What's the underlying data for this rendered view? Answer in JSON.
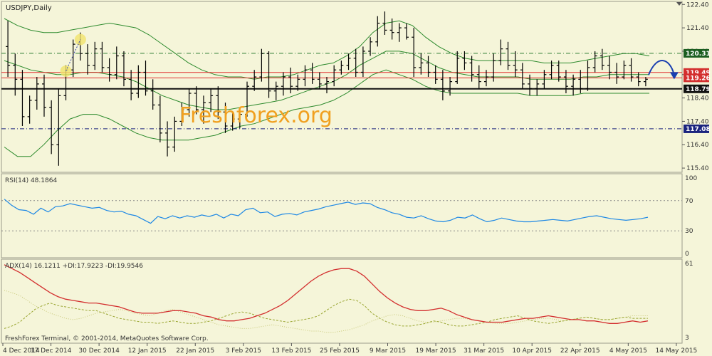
{
  "window": {
    "title": "USDJPY,Daily",
    "watermark": "Freshforex.org",
    "copyright": "FreshForex Terminal, © 2001-2014, MetaQuotes Software Corp."
  },
  "chart_data": {
    "type": "candlestick-ohlc",
    "symbol": "USDJPY",
    "timeframe": "Daily",
    "price_axis": {
      "ylim": [
        115.25,
        122.5
      ],
      "ticks": [
        122.4,
        121.4,
        120.4,
        119.4,
        118.4,
        117.4,
        116.4,
        115.4
      ],
      "tick_labels": [
        "122.40",
        "121.40",
        "120.40",
        "119.40",
        "118.40",
        "117.40",
        "116.40",
        "115.40"
      ]
    },
    "x_axis": {
      "labels": [
        "4 Dec 2014",
        "17 Dec 2014",
        "30 Dec 2014",
        "12 Jan 2015",
        "22 Jan 2015",
        "3 Feb 2015",
        "13 Feb 2015",
        "25 Feb 2015",
        "9 Mar 2015",
        "19 Mar 2015",
        "31 Mar 2015",
        "10 Apr 2015",
        "22 Apr 2015",
        "4 May 2015",
        "14 May 2015"
      ]
    },
    "levels": [
      {
        "value": 120.31,
        "label": "120.31",
        "style": "dash-dot",
        "color": "#2e7d32",
        "tag_bg": "#1b5e20"
      },
      {
        "value": 119.49,
        "label": "119.49",
        "style": "solid",
        "color": "#e03030",
        "tag_bg": "#d32f2f"
      },
      {
        "value": 119.26,
        "label": "119.26",
        "style": "solid",
        "color": "#e03030",
        "tag_bg": "#d32f2f"
      },
      {
        "value": 118.79,
        "label": "118.79",
        "style": "solid-thick",
        "color": "#111111",
        "tag_bg": "#111111"
      },
      {
        "value": 117.08,
        "label": "117.08",
        "style": "dash-dot",
        "color": "#1a237e",
        "tag_bg": "#1a237e"
      }
    ],
    "bollinger": {
      "upper": [
        121.8,
        121.5,
        121.3,
        121.2,
        121.2,
        121.3,
        121.4,
        121.5,
        121.6,
        121.5,
        121.4,
        121.1,
        120.7,
        120.3,
        119.9,
        119.6,
        119.4,
        119.3,
        119.3,
        119.2,
        119.3,
        119.3,
        119.4,
        119.6,
        119.8,
        119.9,
        120.2,
        120.6,
        121.2,
        121.6,
        121.7,
        121.5,
        121.0,
        120.6,
        120.3,
        120.1,
        120.0,
        120.0,
        120.0,
        120.0,
        120.0,
        119.9,
        119.9,
        119.9,
        120.0,
        120.1,
        120.2,
        120.3,
        120.3,
        120.2
      ],
      "middle": [
        120.0,
        119.8,
        119.6,
        119.5,
        119.4,
        119.4,
        119.5,
        119.5,
        119.4,
        119.3,
        119.1,
        118.8,
        118.5,
        118.3,
        118.1,
        118.0,
        117.9,
        117.9,
        118.0,
        118.1,
        118.2,
        118.3,
        118.5,
        118.7,
        118.9,
        119.1,
        119.4,
        119.8,
        120.1,
        120.4,
        120.4,
        120.3,
        120.0,
        119.7,
        119.5,
        119.4,
        119.3,
        119.3,
        119.3,
        119.3,
        119.2,
        119.2,
        119.2,
        119.2,
        119.3,
        119.3,
        119.4,
        119.4,
        119.4,
        119.4
      ],
      "lower": [
        116.3,
        115.9,
        115.9,
        116.4,
        117.0,
        117.5,
        117.7,
        117.7,
        117.5,
        117.2,
        116.9,
        116.7,
        116.6,
        116.6,
        116.6,
        116.7,
        116.8,
        117.0,
        117.2,
        117.3,
        117.5,
        117.7,
        117.9,
        118.0,
        118.1,
        118.3,
        118.6,
        119.0,
        119.4,
        119.6,
        119.4,
        119.2,
        118.9,
        118.7,
        118.6,
        118.6,
        118.6,
        118.6,
        118.6,
        118.6,
        118.5,
        118.5,
        118.5,
        118.5,
        118.6,
        118.6,
        118.6,
        118.6,
        118.6,
        118.6
      ]
    },
    "ohlc": [
      [
        120.6,
        121.7,
        119.3,
        119.8
      ],
      [
        119.8,
        120.3,
        118.5,
        119.2
      ],
      [
        119.2,
        119.6,
        117.2,
        117.6
      ],
      [
        117.6,
        118.5,
        117.3,
        118.3
      ],
      [
        118.3,
        119.3,
        117.9,
        119.0
      ],
      [
        119.0,
        119.4,
        117.6,
        118.0
      ],
      [
        118.0,
        118.3,
        116.0,
        116.4
      ],
      [
        116.4,
        118.8,
        115.5,
        118.5
      ],
      [
        118.5,
        119.8,
        118.3,
        119.6
      ],
      [
        119.6,
        120.9,
        119.3,
        120.7
      ],
      [
        120.7,
        121.2,
        120.0,
        120.3
      ],
      [
        120.3,
        120.7,
        119.4,
        119.8
      ],
      [
        119.8,
        120.8,
        119.6,
        120.5
      ],
      [
        120.5,
        120.8,
        119.5,
        119.7
      ],
      [
        119.7,
        120.1,
        119.1,
        119.4
      ],
      [
        119.4,
        120.6,
        119.2,
        120.2
      ],
      [
        120.2,
        120.4,
        118.9,
        119.2
      ],
      [
        119.2,
        119.6,
        118.3,
        118.6
      ],
      [
        118.6,
        119.8,
        118.4,
        119.5
      ],
      [
        119.5,
        120.0,
        118.5,
        118.7
      ],
      [
        118.7,
        119.2,
        117.9,
        118.1
      ],
      [
        118.1,
        118.5,
        116.5,
        116.9
      ],
      [
        116.9,
        117.4,
        115.9,
        116.3
      ],
      [
        116.3,
        117.6,
        116.1,
        117.4
      ],
      [
        117.4,
        118.2,
        117.2,
        117.9
      ],
      [
        117.9,
        118.8,
        117.6,
        118.6
      ],
      [
        118.6,
        118.9,
        117.7,
        117.9
      ],
      [
        117.9,
        118.5,
        117.3,
        118.2
      ],
      [
        118.2,
        118.8,
        117.8,
        118.5
      ],
      [
        118.5,
        118.9,
        117.5,
        117.8
      ],
      [
        117.8,
        118.2,
        116.9,
        117.2
      ],
      [
        117.2,
        117.8,
        117.0,
        117.5
      ],
      [
        117.5,
        117.9,
        117.1,
        117.7
      ],
      [
        117.7,
        119.1,
        117.6,
        118.9
      ],
      [
        118.9,
        119.6,
        118.7,
        119.3
      ],
      [
        119.3,
        120.5,
        119.1,
        120.3
      ],
      [
        120.3,
        120.4,
        118.4,
        118.7
      ],
      [
        118.7,
        119.1,
        118.3,
        118.9
      ],
      [
        118.9,
        119.5,
        118.5,
        119.3
      ],
      [
        119.3,
        119.7,
        118.6,
        118.9
      ],
      [
        118.9,
        119.4,
        118.7,
        119.2
      ],
      [
        119.2,
        119.8,
        118.9,
        119.6
      ],
      [
        119.6,
        119.9,
        119.0,
        119.2
      ],
      [
        119.2,
        119.5,
        118.8,
        119.0
      ],
      [
        119.0,
        119.3,
        118.6,
        119.1
      ],
      [
        119.1,
        119.8,
        118.9,
        119.6
      ],
      [
        119.6,
        120.0,
        119.4,
        119.8
      ],
      [
        119.8,
        120.3,
        119.6,
        120.1
      ],
      [
        120.1,
        120.5,
        119.3,
        119.5
      ],
      [
        119.5,
        120.6,
        119.3,
        120.4
      ],
      [
        120.4,
        121.0,
        120.2,
        120.8
      ],
      [
        120.8,
        121.9,
        120.6,
        121.6
      ],
      [
        121.6,
        122.1,
        121.1,
        121.3
      ],
      [
        121.3,
        121.8,
        120.9,
        121.2
      ],
      [
        121.2,
        121.6,
        120.8,
        121.4
      ],
      [
        121.4,
        121.6,
        120.9,
        121.0
      ],
      [
        121.0,
        121.4,
        119.3,
        119.7
      ],
      [
        119.7,
        120.3,
        119.4,
        119.9
      ],
      [
        119.9,
        120.2,
        119.3,
        119.5
      ],
      [
        119.5,
        119.8,
        119.0,
        119.2
      ],
      [
        119.2,
        119.6,
        118.3,
        118.7
      ],
      [
        118.7,
        119.3,
        118.5,
        119.1
      ],
      [
        119.1,
        120.4,
        119.0,
        120.1
      ],
      [
        120.1,
        120.4,
        119.6,
        119.9
      ],
      [
        119.9,
        120.2,
        119.1,
        119.4
      ],
      [
        119.4,
        119.8,
        118.8,
        119.1
      ],
      [
        119.1,
        119.6,
        118.9,
        119.3
      ],
      [
        119.3,
        120.3,
        119.1,
        120.0
      ],
      [
        120.0,
        120.9,
        119.8,
        120.5
      ],
      [
        120.5,
        120.8,
        119.6,
        119.8
      ],
      [
        119.8,
        120.4,
        119.3,
        119.6
      ],
      [
        119.6,
        119.9,
        118.8,
        119.0
      ],
      [
        119.0,
        119.4,
        118.5,
        118.8
      ],
      [
        118.8,
        119.2,
        118.5,
        119.0
      ],
      [
        119.0,
        119.6,
        118.8,
        119.4
      ],
      [
        119.4,
        120.0,
        119.2,
        119.8
      ],
      [
        119.8,
        120.0,
        119.1,
        119.3
      ],
      [
        119.3,
        119.6,
        118.6,
        118.9
      ],
      [
        118.9,
        119.4,
        118.5,
        119.2
      ],
      [
        119.2,
        119.6,
        118.6,
        118.8
      ],
      [
        118.8,
        120.0,
        118.7,
        119.7
      ],
      [
        119.7,
        120.4,
        119.5,
        120.2
      ],
      [
        120.2,
        120.5,
        119.6,
        119.8
      ],
      [
        119.8,
        120.2,
        119.2,
        119.5
      ],
      [
        119.5,
        119.9,
        119.0,
        119.3
      ],
      [
        119.3,
        120.0,
        119.2,
        119.8
      ],
      [
        119.8,
        120.1,
        119.1,
        119.3
      ],
      [
        119.3,
        119.5,
        118.9,
        119.1
      ],
      [
        119.1,
        119.3,
        118.9,
        119.2
      ]
    ],
    "highlights": [
      {
        "index": 8,
        "price": 119.55
      },
      {
        "index": 10,
        "price": 120.9
      }
    ],
    "rsi": {
      "label": "RSI(14) 48.1864",
      "period": 14,
      "value": 48.1864,
      "ylim": [
        0,
        100
      ],
      "ticks": [
        100,
        70,
        30,
        0
      ],
      "levels": [
        70,
        30
      ],
      "values": [
        72,
        64,
        58,
        57,
        52,
        60,
        55,
        62,
        63,
        66,
        64,
        62,
        60,
        61,
        57,
        55,
        56,
        52,
        50,
        45,
        40,
        49,
        46,
        50,
        47,
        50,
        48,
        51,
        49,
        52,
        47,
        52,
        50,
        58,
        60,
        54,
        55,
        49,
        52,
        53,
        51,
        55,
        57,
        59,
        62,
        64,
        66,
        68,
        65,
        67,
        66,
        61,
        58,
        54,
        52,
        48,
        47,
        50,
        46,
        43,
        42,
        44,
        48,
        47,
        51,
        46,
        42,
        44,
        47,
        45,
        43,
        42,
        42,
        43,
        44,
        45,
        44,
        43,
        45,
        47,
        49,
        50,
        48,
        46,
        45,
        44,
        45,
        46,
        48
      ]
    },
    "adx": {
      "label": "ADX(14) 16.1211 +DI:17.9223 -DI:19.9546",
      "period": 14,
      "adx_value": 16.1211,
      "plus_di": 17.9223,
      "minus_di": 19.9546,
      "ylim": [
        3,
        61
      ],
      "ticks": [
        61,
        3
      ],
      "adx": [
        60,
        57,
        54,
        50,
        46,
        42,
        38,
        35,
        33,
        32,
        31,
        30,
        30,
        29,
        28,
        27,
        25,
        23,
        22,
        22,
        22,
        23,
        24,
        24,
        23,
        22,
        20,
        19,
        17,
        16,
        16,
        17,
        18,
        20,
        22,
        25,
        28,
        32,
        37,
        42,
        47,
        51,
        54,
        56,
        57,
        57,
        55,
        51,
        45,
        39,
        34,
        30,
        27,
        25,
        24,
        24,
        25,
        26,
        24,
        21,
        19,
        17,
        16,
        15,
        15,
        15,
        16,
        17,
        18,
        18,
        19,
        20,
        19,
        18,
        17,
        17,
        16,
        16,
        15,
        14,
        14,
        15,
        16,
        15,
        16
      ],
      "plus_di_values": [
        10,
        12,
        15,
        20,
        25,
        28,
        30,
        28,
        27,
        26,
        25,
        24,
        24,
        22,
        20,
        18,
        17,
        16,
        15,
        15,
        14,
        15,
        16,
        15,
        14,
        14,
        15,
        16,
        18,
        20,
        22,
        23,
        22,
        20,
        18,
        17,
        16,
        15,
        16,
        17,
        18,
        20,
        24,
        28,
        31,
        33,
        32,
        28,
        22,
        18,
        15,
        13,
        12,
        12,
        13,
        14,
        16,
        15,
        13,
        12,
        12,
        13,
        14,
        15,
        17,
        18,
        19,
        20,
        18,
        16,
        15,
        14,
        15,
        16,
        17,
        18,
        19,
        18,
        17,
        17,
        18,
        19,
        18,
        18,
        18
      ],
      "minus_di_values": [
        40,
        38,
        36,
        32,
        28,
        25,
        22,
        20,
        18,
        17,
        18,
        20,
        22,
        23,
        24,
        25,
        24,
        22,
        21,
        20,
        22,
        24,
        25,
        23,
        21,
        19,
        17,
        15,
        13,
        12,
        11,
        10,
        10,
        11,
        12,
        13,
        12,
        11,
        10,
        9,
        8,
        8,
        7,
        7,
        8,
        9,
        11,
        13,
        16,
        18,
        20,
        21,
        20,
        18,
        16,
        15,
        15,
        16,
        17,
        18,
        18,
        17,
        16,
        15,
        14,
        14,
        14,
        15,
        16,
        17,
        18,
        18,
        17,
        16,
        17,
        18,
        19,
        18,
        17,
        17,
        18,
        19,
        20,
        20,
        20
      ]
    }
  },
  "colors": {
    "background": "#f5f5d9",
    "panel_bg": "#f7f7dc",
    "bars": "#000000",
    "bollinger": "#2e8b2e",
    "rsi": "#1e88e5",
    "adx": "#d32f2f",
    "plus_di": "#9aa632",
    "minus_di": "#c8c878",
    "arrow": "#1a3fb0",
    "highlight": "#f1e46b"
  }
}
